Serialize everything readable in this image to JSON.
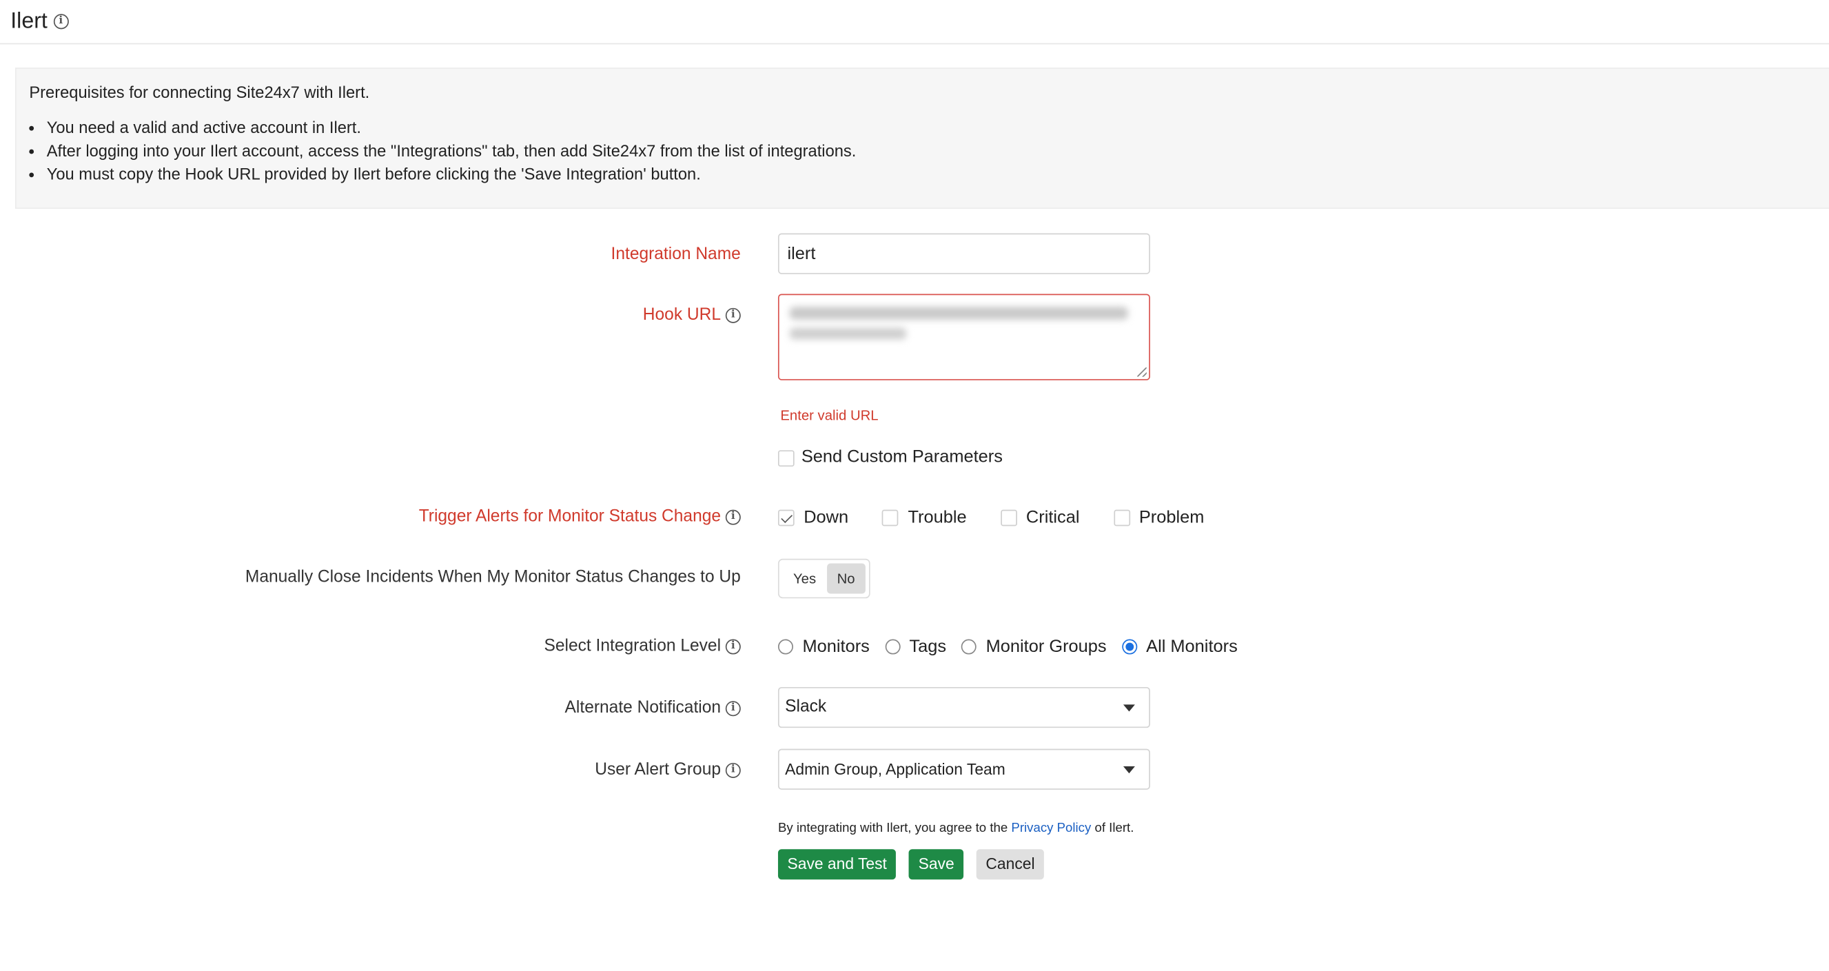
{
  "header": {
    "title": "Ilert"
  },
  "prerequisites": {
    "heading": "Prerequisites for connecting Site24x7 with Ilert.",
    "items": [
      "You need a valid and active account in Ilert.",
      "After logging into your Ilert account, access the \"Integrations\" tab, then add Site24x7 from the list of integrations.",
      "You must copy the Hook URL provided by Ilert before clicking the 'Save Integration' button."
    ]
  },
  "form": {
    "integration_name": {
      "label": "Integration Name",
      "value": "ilert"
    },
    "hook_url": {
      "label": "Hook URL",
      "error": "Enter valid URL"
    },
    "custom_params": {
      "label": "Send Custom Parameters",
      "checked": false
    },
    "trigger_alerts": {
      "label": "Trigger Alerts for Monitor Status Change",
      "options": [
        {
          "label": "Down",
          "checked": true
        },
        {
          "label": "Trouble",
          "checked": false
        },
        {
          "label": "Critical",
          "checked": false
        },
        {
          "label": "Problem",
          "checked": false
        }
      ]
    },
    "manual_close": {
      "label": "Manually Close Incidents When My Monitor Status Changes to Up",
      "yes": "Yes",
      "no": "No",
      "selected": "No"
    },
    "integration_level": {
      "label": "Select Integration Level",
      "options": [
        {
          "label": "Monitors",
          "checked": false
        },
        {
          "label": "Tags",
          "checked": false
        },
        {
          "label": "Monitor Groups",
          "checked": false
        },
        {
          "label": "All Monitors",
          "checked": true
        }
      ]
    },
    "alternate_notification": {
      "label": "Alternate Notification",
      "value": "Slack"
    },
    "user_alert_group": {
      "label": "User Alert Group",
      "value": "Admin Group, Application Team"
    },
    "agreement": {
      "prefix": "By integrating with Ilert, you agree to the",
      "link": "Privacy Policy",
      "suffix": "of Ilert."
    },
    "buttons": {
      "save_and_test": "Save and Test",
      "save": "Save",
      "cancel": "Cancel"
    }
  },
  "colors": {
    "required_label": "#d03a2c",
    "primary_button": "#1e8a46",
    "link": "#1a5fc2",
    "radio_selected": "#1a6fe0"
  }
}
